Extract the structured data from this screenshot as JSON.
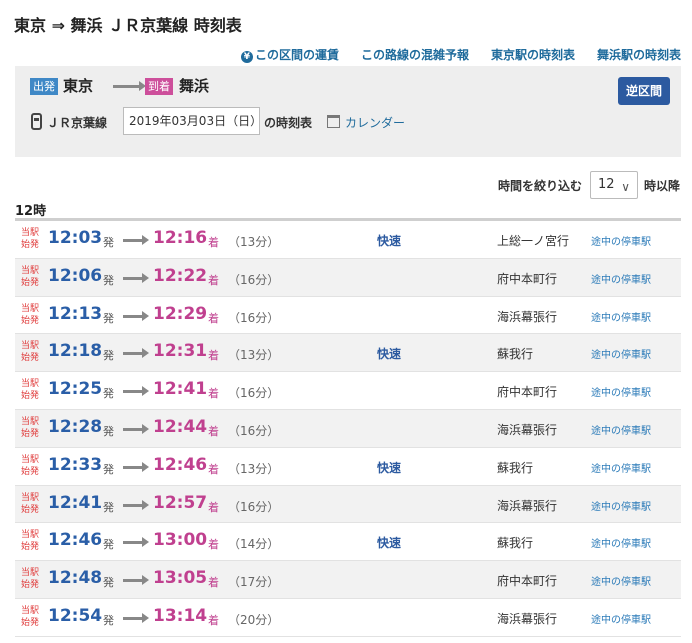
{
  "page": {
    "title": "東京 ⇒ 舞浜 ＪＲ京葉線 時刻表"
  },
  "top_links": {
    "fare": "この区間の運賃",
    "congestion": "この路線の混雑予報",
    "tokyo_timetable": "東京駅の時刻表",
    "maihama_timetable": "舞浜駅の時刻表"
  },
  "search": {
    "dep_badge": "出発",
    "from": "東京",
    "arr_badge": "到着",
    "to": "舞浜",
    "reverse": "逆区間",
    "line": "ＪＲ京葉線",
    "date": "2019年03月03日（日）",
    "timetable_suffix": "の時刻表",
    "calendar": "カレンダー"
  },
  "filter": {
    "label": "時間を絞り込む",
    "selected_hour": "12",
    "after": "時以降"
  },
  "hour_heading": "12時",
  "labels": {
    "origin": "当駅始発",
    "hatsu": "発",
    "chaku": "着",
    "stops": "途中の停車駅"
  },
  "trains": [
    {
      "dep": "12:03",
      "arr": "12:16",
      "dur": "（13分）",
      "kind": "快速",
      "dest": "上総一ノ宮行"
    },
    {
      "dep": "12:06",
      "arr": "12:22",
      "dur": "（16分）",
      "kind": "",
      "dest": "府中本町行"
    },
    {
      "dep": "12:13",
      "arr": "12:29",
      "dur": "（16分）",
      "kind": "",
      "dest": "海浜幕張行"
    },
    {
      "dep": "12:18",
      "arr": "12:31",
      "dur": "（13分）",
      "kind": "快速",
      "dest": "蘇我行"
    },
    {
      "dep": "12:25",
      "arr": "12:41",
      "dur": "（16分）",
      "kind": "",
      "dest": "府中本町行"
    },
    {
      "dep": "12:28",
      "arr": "12:44",
      "dur": "（16分）",
      "kind": "",
      "dest": "海浜幕張行"
    },
    {
      "dep": "12:33",
      "arr": "12:46",
      "dur": "（13分）",
      "kind": "快速",
      "dest": "蘇我行"
    },
    {
      "dep": "12:41",
      "arr": "12:57",
      "dur": "（16分）",
      "kind": "",
      "dest": "海浜幕張行"
    },
    {
      "dep": "12:46",
      "arr": "13:00",
      "dur": "（14分）",
      "kind": "快速",
      "dest": "蘇我行"
    },
    {
      "dep": "12:48",
      "arr": "13:05",
      "dur": "（17分）",
      "kind": "",
      "dest": "府中本町行"
    },
    {
      "dep": "12:54",
      "arr": "13:14",
      "dur": "（20分）",
      "kind": "",
      "dest": "海浜幕張行"
    }
  ]
}
